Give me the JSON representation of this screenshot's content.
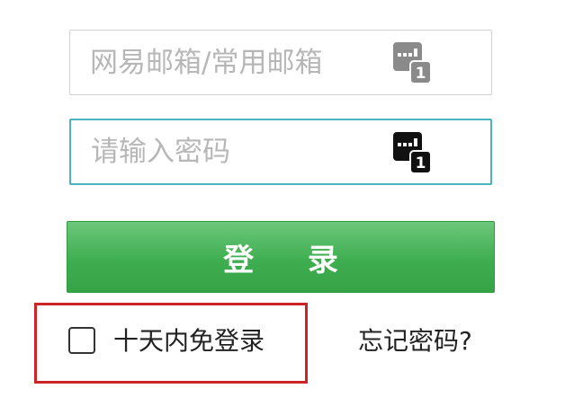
{
  "login_form": {
    "username": {
      "value": "",
      "placeholder": "网易邮箱/常用邮箱"
    },
    "password": {
      "value": "",
      "placeholder": "请输入密码"
    },
    "icons": {
      "username_icon": "soft-keyboard-icon",
      "password_icon": "soft-keyboard-icon"
    },
    "login_button_label": "登 录",
    "remember_label": "十天内免登录",
    "remember_checked": false,
    "forgot_password_label": "忘记密码?"
  },
  "colors": {
    "button_green": "#3fae50",
    "focus_border": "#4ab3bd",
    "highlight_red": "#cc2427",
    "username_icon": "#8a8a8a",
    "password_icon": "#111111"
  }
}
